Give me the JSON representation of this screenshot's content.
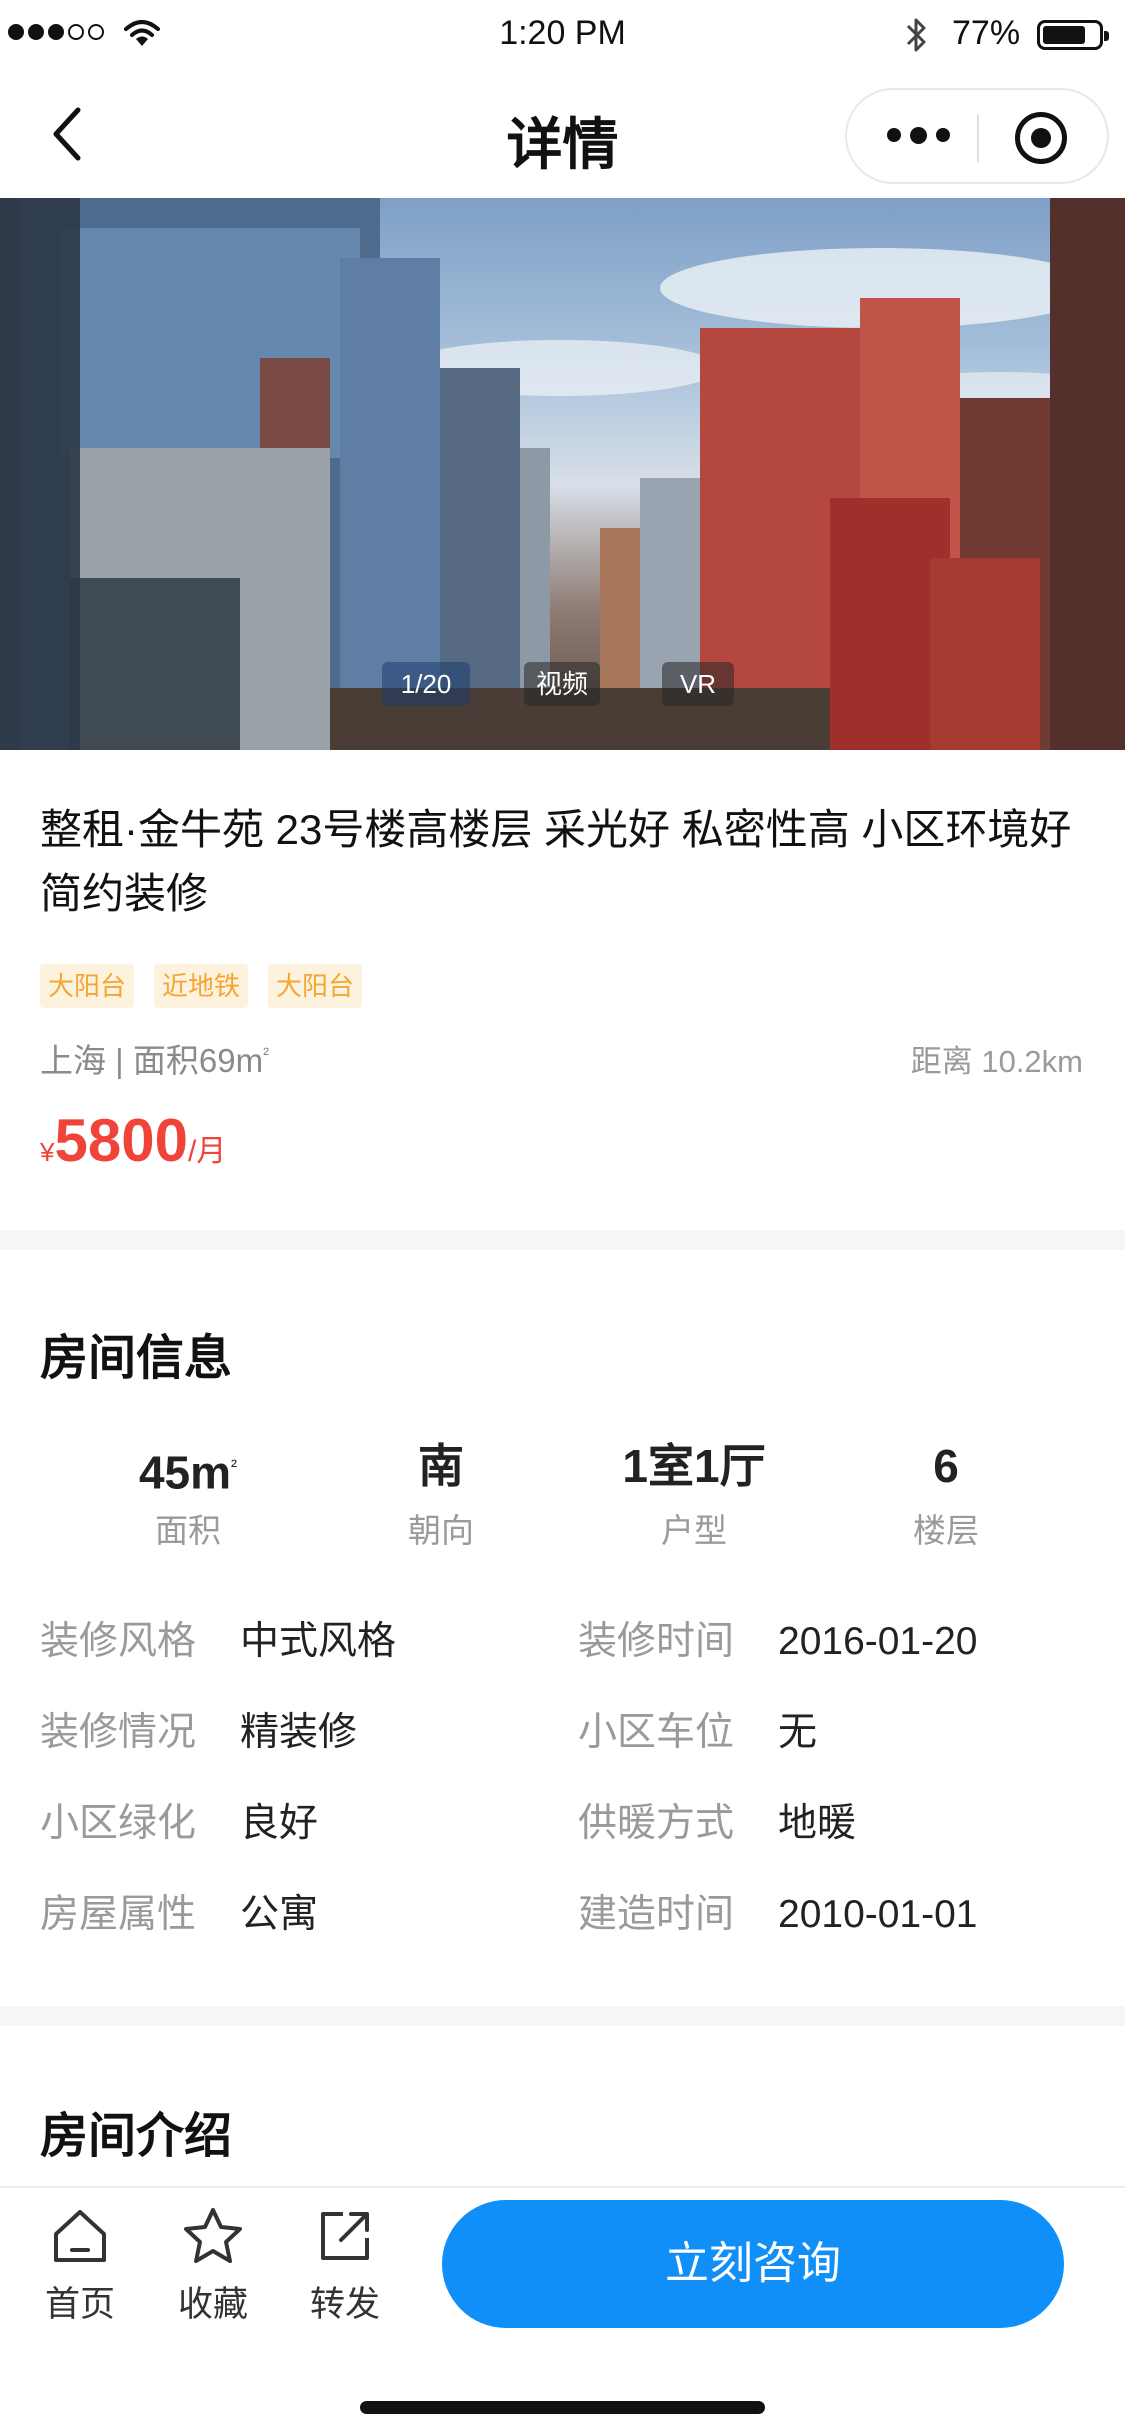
{
  "status_bar": {
    "time": "1:20 PM",
    "battery_percent": "77%",
    "battery_level": 0.77,
    "icons": [
      "signal-icon",
      "wifi-icon",
      "bluetooth-icon",
      "battery-icon"
    ]
  },
  "nav": {
    "title": "详情",
    "icons": [
      "back-icon",
      "more-icon",
      "target-icon"
    ]
  },
  "hero": {
    "counter": "1/20",
    "video_label": "视频",
    "vr_label": "VR"
  },
  "listing": {
    "title": "整租·金牛苑 23号楼高楼层 采光好 私密性高 小区环境好 简约装修",
    "tags": [
      "大阳台",
      "近地铁",
      "大阳台"
    ],
    "location": "上海 | 面积69m",
    "area_sup": "²",
    "distance": "距离 10.2km",
    "price_currency": "¥",
    "price": "5800",
    "price_unit": "/月",
    "tag_color": "#f3a632",
    "price_color": "#f0433a"
  },
  "room_info": {
    "title": "房间信息",
    "stats": [
      {
        "value": "45m",
        "sup": "²",
        "label": "面积"
      },
      {
        "value": "南",
        "sup": "",
        "label": "朝向"
      },
      {
        "value": "1室1厅",
        "sup": "",
        "label": "户型"
      },
      {
        "value": "6",
        "sup": "",
        "label": "楼层"
      }
    ],
    "details": [
      [
        {
          "key": "装修风格",
          "value": "中式风格"
        },
        {
          "key": "装修时间",
          "value": "2016-01-20"
        }
      ],
      [
        {
          "key": "装修情况",
          "value": "精装修"
        },
        {
          "key": "小区车位",
          "value": "无"
        }
      ],
      [
        {
          "key": "小区绿化",
          "value": "良好"
        },
        {
          "key": "供暖方式",
          "value": "地暖"
        }
      ],
      [
        {
          "key": "房屋属性",
          "value": "公寓"
        },
        {
          "key": "建造时间",
          "value": "2010-01-01"
        }
      ]
    ]
  },
  "room_intro": {
    "title": "房间介绍"
  },
  "bottom_bar": {
    "tabs": [
      {
        "label": "首页",
        "icon": "home-icon"
      },
      {
        "label": "收藏",
        "icon": "star-icon"
      },
      {
        "label": "转发",
        "icon": "share-icon"
      }
    ],
    "consult_label": "立刻咨询",
    "accent_color": "#0f8ff7"
  }
}
